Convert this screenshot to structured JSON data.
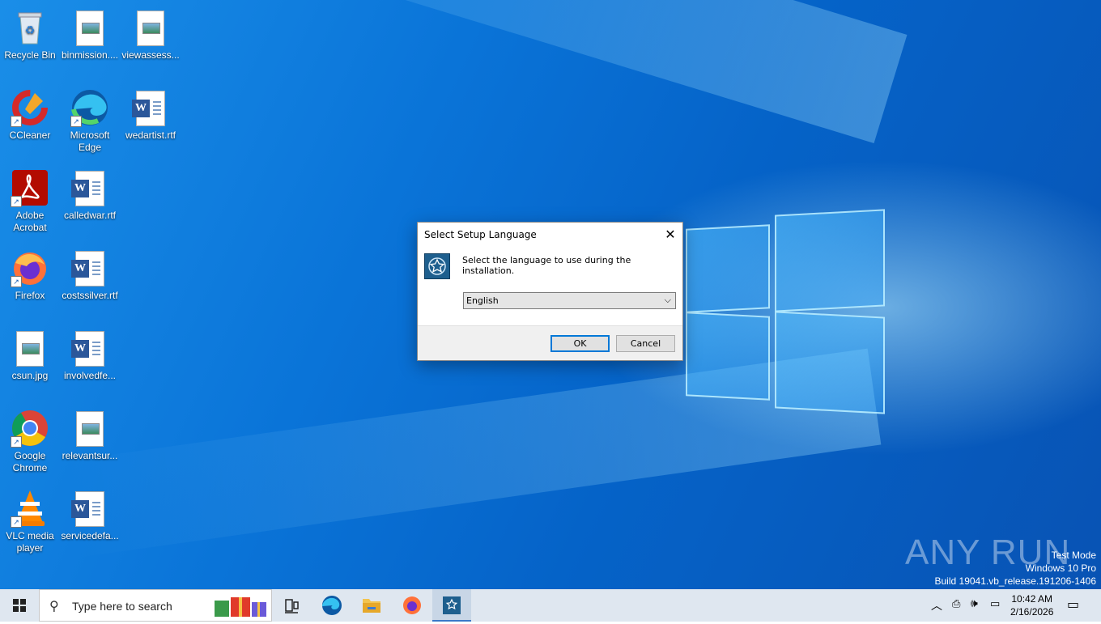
{
  "desktop": {
    "icons": [
      {
        "label": "Recycle Bin",
        "type": "recycle"
      },
      {
        "label": "binmission....",
        "type": "image-file"
      },
      {
        "label": "viewassess...",
        "type": "image-file"
      },
      {
        "label": "CCleaner",
        "type": "ccleaner"
      },
      {
        "label": "Microsoft Edge",
        "type": "edge"
      },
      {
        "label": "wedartist.rtf",
        "type": "word"
      },
      {
        "label": "Adobe Acrobat",
        "type": "acrobat"
      },
      {
        "label": "calledwar.rtf",
        "type": "word"
      },
      {
        "label": "Firefox",
        "type": "firefox"
      },
      {
        "label": "costssilver.rtf",
        "type": "word"
      },
      {
        "label": "csun.jpg",
        "type": "image-file"
      },
      {
        "label": "involvedfe...",
        "type": "word"
      },
      {
        "label": "Google Chrome",
        "type": "chrome"
      },
      {
        "label": "relevantsur...",
        "type": "image-file"
      },
      {
        "label": "VLC media player",
        "type": "vlc"
      },
      {
        "label": "servicedefa...",
        "type": "word"
      }
    ]
  },
  "dialog": {
    "title": "Select Setup Language",
    "message": "Select the language to use during the installation.",
    "language_selected": "English",
    "ok_label": "OK",
    "cancel_label": "Cancel"
  },
  "watermark": {
    "brand": "ANY RUN",
    "line1": "Test Mode",
    "line2": "Windows 10 Pro",
    "line3": "Build 19041.vb_release.191206-1406"
  },
  "taskbar": {
    "search_placeholder": "Type here to search",
    "time": "10:42 AM",
    "date": "2/16/2026",
    "apps": [
      "task-view",
      "edge",
      "file-explorer",
      "firefox",
      "setup-installer"
    ]
  },
  "colors": {
    "accent": "#0078d7",
    "desktop_blue": "#0a74d8",
    "taskbar": "#dfe7f0"
  }
}
